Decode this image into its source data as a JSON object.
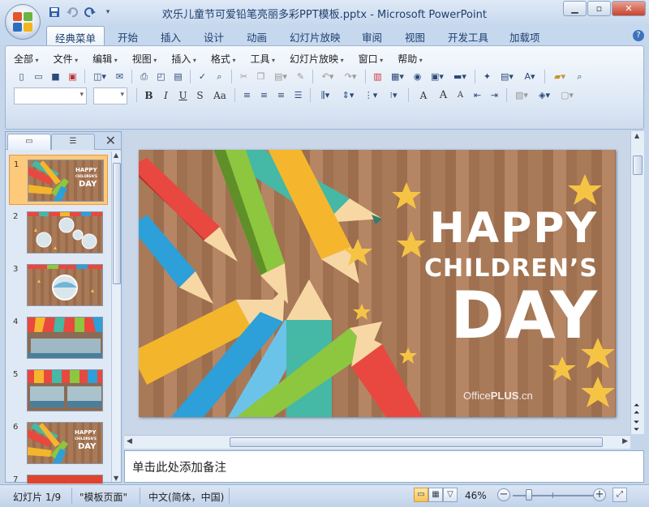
{
  "window": {
    "title": "欢乐儿童节可爱铅笔亮丽多彩PPT模板.pptx - Microsoft PowerPoint",
    "minimize": "▁",
    "maximize": "▫",
    "close": "✕"
  },
  "quick_access": [
    "save-icon",
    "undo-icon",
    "redo-icon",
    "customize-qat-icon"
  ],
  "ribbon_tabs": [
    {
      "label": "经典菜单",
      "active": true
    },
    {
      "label": "开始"
    },
    {
      "label": "插入"
    },
    {
      "label": "设计"
    },
    {
      "label": "动画"
    },
    {
      "label": "幻灯片放映"
    },
    {
      "label": "审阅"
    },
    {
      "label": "视图"
    },
    {
      "label": "开发工具"
    },
    {
      "label": "加载项"
    }
  ],
  "help": "?",
  "classic_menu": [
    "全部",
    "文件",
    "编辑",
    "视图",
    "插入",
    "格式",
    "工具",
    "幻灯片放映",
    "窗口",
    "帮助"
  ],
  "format_buttons": {
    "bold": "B",
    "italic": "I",
    "underline": "U",
    "shadow": "S",
    "case": "Aa",
    "font_color": "A",
    "grow": "A",
    "shrink": "A"
  },
  "panel": {
    "close": "✕",
    "slide_numbers": [
      "1",
      "2",
      "3",
      "4",
      "5",
      "6",
      "7"
    ],
    "selected": "1"
  },
  "slide": {
    "line1": "HAPPY",
    "line2": "CHILDREN’S",
    "line3": "DAY",
    "brand_a": "Office",
    "brand_b": "PLUS",
    "brand_c": ".cn"
  },
  "thumb_text": {
    "line1": "HAPPY",
    "line2": "CHILDREN'S",
    "line3": "DAY"
  },
  "notes_placeholder": "单击此处添加备注",
  "status": {
    "slide_info": "幻灯片 1/9",
    "theme": "\"模板页面\"",
    "language": "中文(简体，中国)",
    "zoom": "46%",
    "zoom_out": "−",
    "zoom_in": "+"
  },
  "colors": {
    "accent": "#1e3f6d",
    "wood": "#a97a58",
    "star": "#f6c445",
    "selected_thumb": "#fdc97a"
  }
}
